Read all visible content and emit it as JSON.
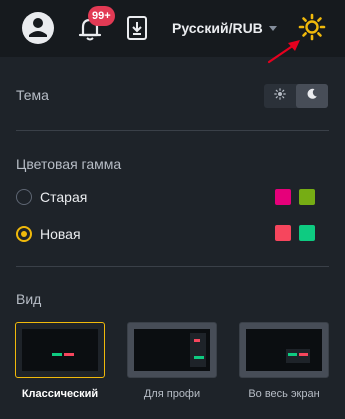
{
  "header": {
    "notification_badge": "99+",
    "language_currency": "Русский/RUB",
    "icons": [
      "user-icon",
      "bell-icon",
      "download-icon",
      "sun-gear-icon",
      "chevron-down-icon"
    ],
    "accent_color": "#f0b90b"
  },
  "settings": {
    "theme": {
      "label": "Тема",
      "options": [
        "light",
        "dark"
      ],
      "selected": "dark"
    },
    "palette": {
      "label": "Цветовая гамма",
      "options": [
        {
          "label": "Старая",
          "checked": false,
          "up_color": "#e6007a",
          "down_color": "#76ad14"
        },
        {
          "label": "Новая",
          "checked": true,
          "up_color": "#f6465d",
          "down_color": "#0ecb81"
        }
      ]
    },
    "view": {
      "label": "Вид",
      "layouts": [
        {
          "label": "Классический",
          "selected": true
        },
        {
          "label": "Для профи",
          "selected": false
        },
        {
          "label": "Во весь экран",
          "selected": false
        }
      ]
    }
  }
}
